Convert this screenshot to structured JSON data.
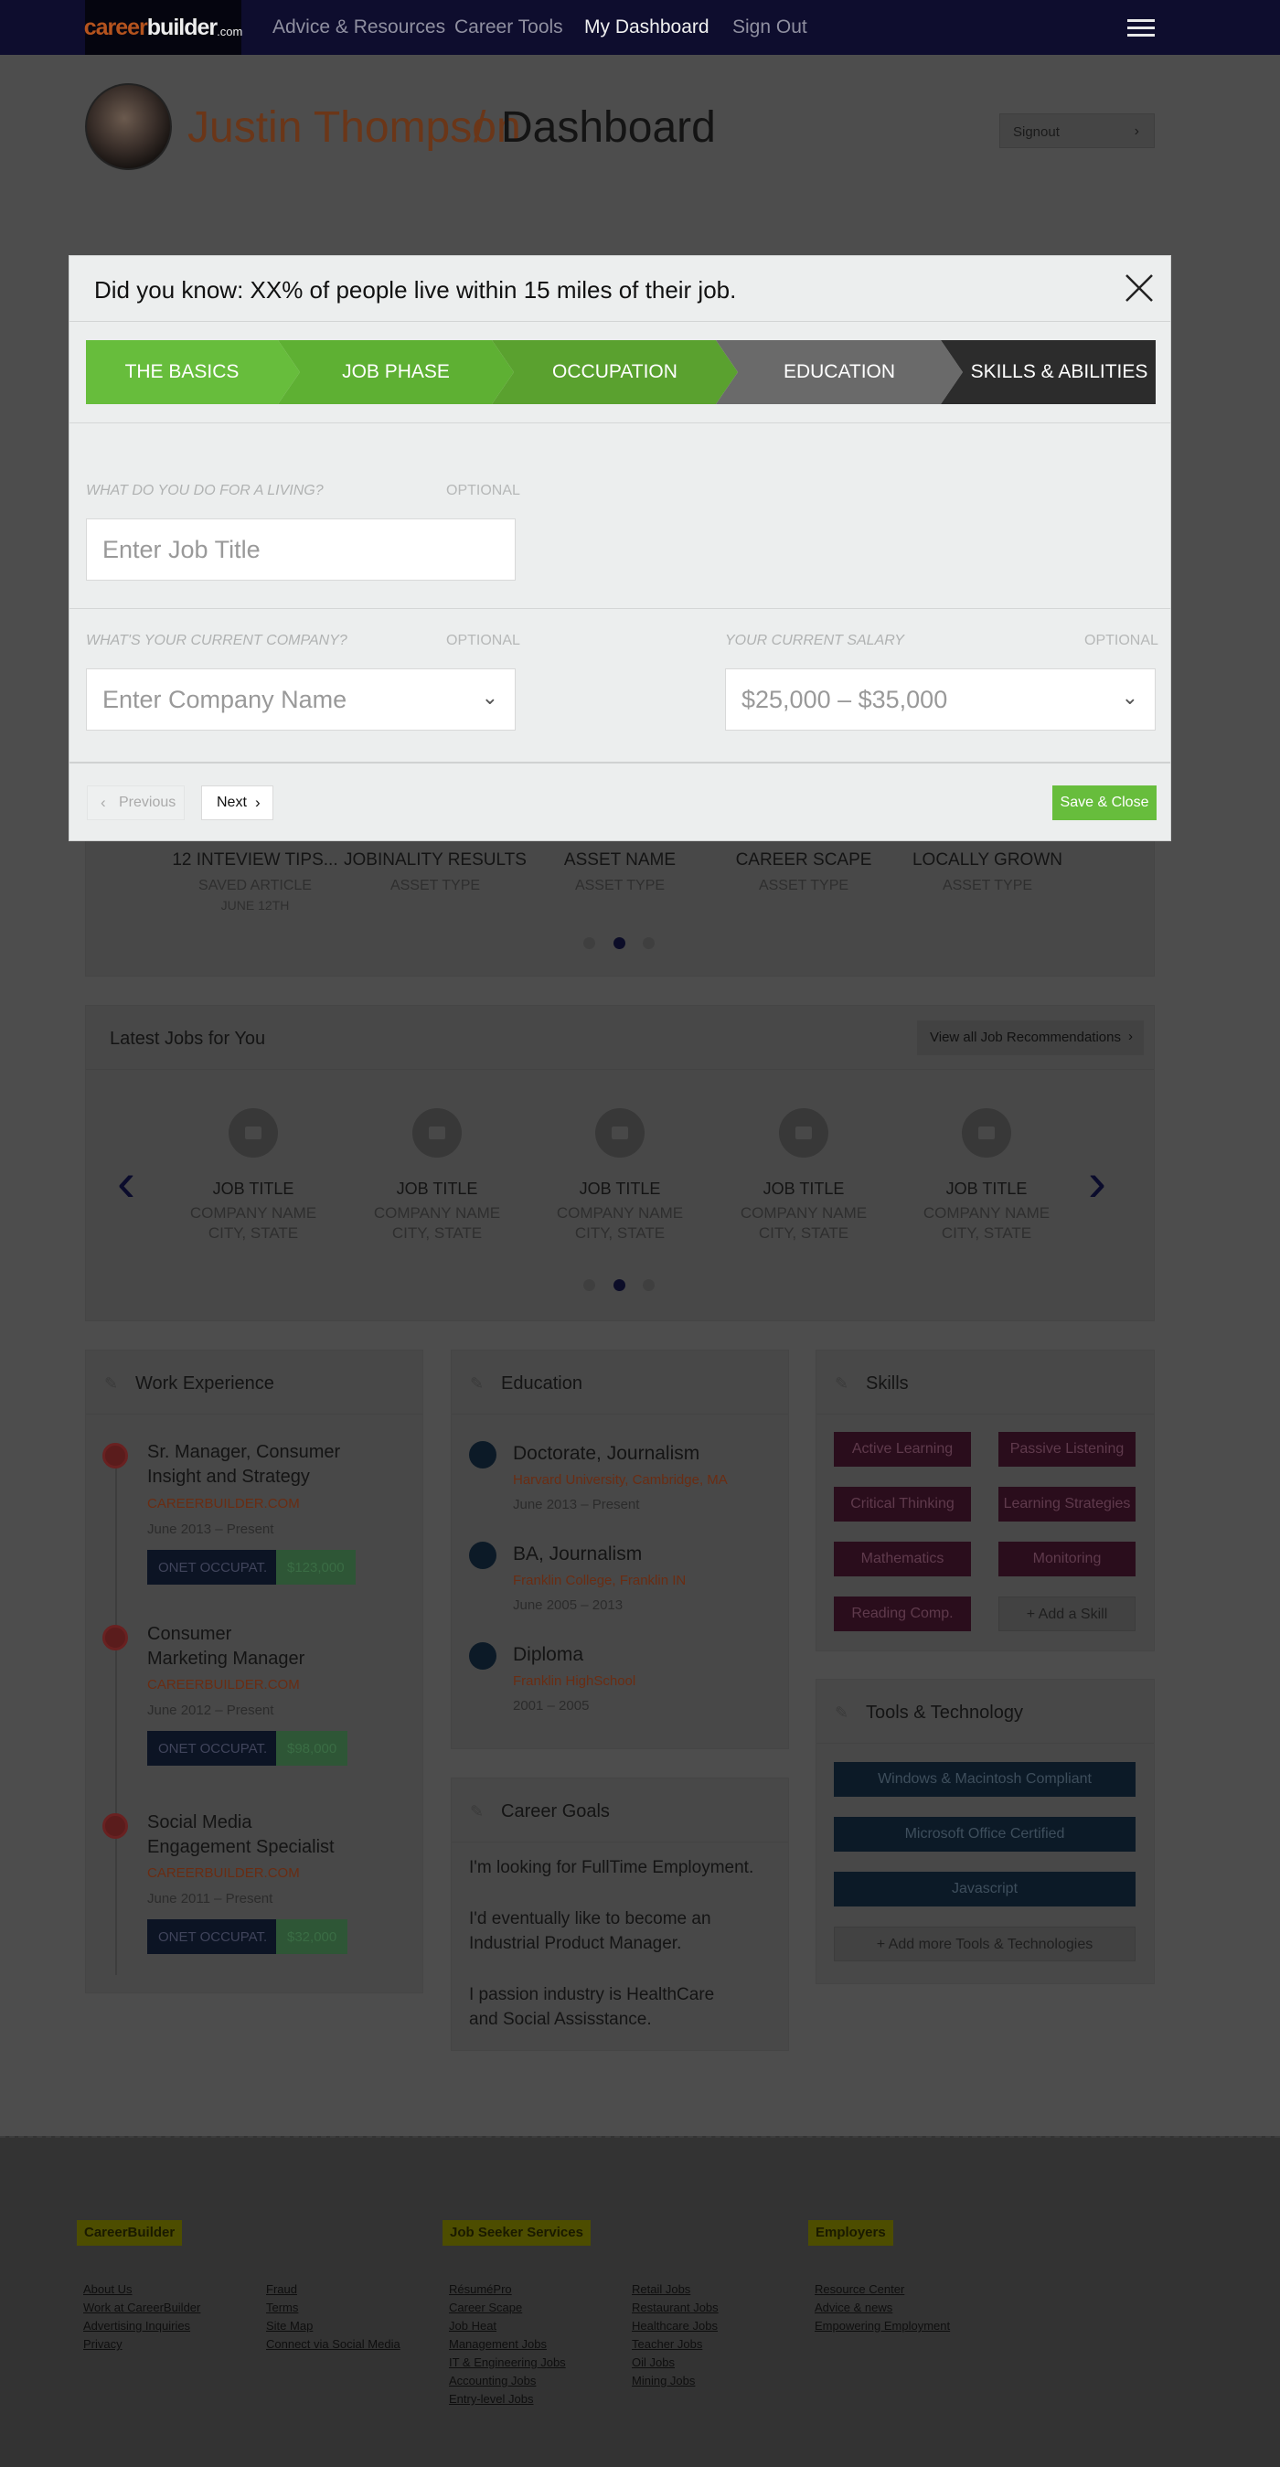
{
  "nav": {
    "logo_career": "career",
    "logo_builder": "builder",
    "logo_com": ".com",
    "links": [
      "Advice & Resources",
      "Career Tools",
      "My Dashboard",
      "Sign Out"
    ]
  },
  "header": {
    "name": "Justin Thompson",
    "slash": "/",
    "page": "Dashboard",
    "signout": "Signout"
  },
  "modal": {
    "title": "Did you know: XX% of people live within 15 miles of their job.",
    "steps": [
      "THE BASICS",
      "JOB PHASE",
      "OCCUPATION",
      "EDUCATION",
      "SKILLS & ABILITIES"
    ],
    "job_label": "WHAT DO YOU DO FOR A LIVING?",
    "optional": "OPTIONAL",
    "job_placeholder": "Enter Job Title",
    "company_label": "WHAT'S YOUR CURRENT COMPANY?",
    "company_placeholder": "Enter Company Name",
    "salary_label": "YOUR CURRENT SALARY",
    "salary_value": "$25,000 – $35,000",
    "prev": "Previous",
    "next": "Next",
    "save": "Save & Close"
  },
  "assets": [
    {
      "title": "12 INTEVIEW TIPS...",
      "type": "SAVED ARTICLE",
      "date": "JUNE 12TH"
    },
    {
      "title": "JOBINALITY RESULTS",
      "type": "ASSET TYPE",
      "date": ""
    },
    {
      "title": "ASSET NAME",
      "type": "ASSET TYPE",
      "date": ""
    },
    {
      "title": "CAREER SCAPE",
      "type": "ASSET TYPE",
      "date": ""
    },
    {
      "title": "LOCALLY GROWN",
      "type": "ASSET TYPE",
      "date": ""
    }
  ],
  "jobs": {
    "title": "Latest Jobs for You",
    "view_all": "View all Job Recommendations",
    "cards": [
      {
        "title": "JOB TITLE",
        "company": "COMPANY NAME",
        "location": "CITY, STATE"
      },
      {
        "title": "JOB TITLE",
        "company": "COMPANY NAME",
        "location": "CITY, STATE"
      },
      {
        "title": "JOB TITLE",
        "company": "COMPANY NAME",
        "location": "CITY, STATE"
      },
      {
        "title": "JOB TITLE",
        "company": "COMPANY NAME",
        "location": "CITY, STATE"
      },
      {
        "title": "JOB TITLE",
        "company": "COMPANY NAME",
        "location": "CITY, STATE"
      }
    ]
  },
  "work": {
    "title": "Work Experience",
    "items": [
      {
        "title1": "Sr. Manager, Consumer",
        "title2": "Insight and Strategy",
        "org": "CAREERBUILDER.COM",
        "dates": "June 2013 – Present",
        "tag": "ONET OCCUPAT.",
        "salary": "$123,000"
      },
      {
        "title1": "Consumer",
        "title2": "Marketing Manager",
        "org": "CAREERBUILDER.COM",
        "dates": "June 2012 – Present",
        "tag": "ONET OCCUPAT.",
        "salary": "$98,000"
      },
      {
        "title1": "Social Media",
        "title2": "Engagement Specialist",
        "org": "CAREERBUILDER.COM",
        "dates": "June 2011 – Present",
        "tag": "ONET OCCUPAT.",
        "salary": "$32,000"
      }
    ]
  },
  "education": {
    "title": "Education",
    "items": [
      {
        "degree": "Doctorate, Journalism",
        "school": "Harvard University, Cambridge, MA",
        "dates": "June 2013 – Present"
      },
      {
        "degree": "BA, Journalism",
        "school": "Franklin College, Franklin IN",
        "dates": "June 2005 – 2013"
      },
      {
        "degree": "Diploma",
        "school": "Franklin HighSchool",
        "dates": "2001 – 2005"
      }
    ]
  },
  "goals": {
    "title": "Career Goals",
    "g1": "I'm looking for FullTime Employment.",
    "g2a": "I'd eventually like to become an",
    "g2b": "Industrial Product Manager.",
    "g3a": "I passion industry is HealthCare",
    "g3b": "and Social Assisstance."
  },
  "skills": {
    "title": "Skills",
    "items": [
      "Active Learning",
      "Passive Listening",
      "Critical Thinking",
      "Learning Strategies",
      "Mathematics",
      "Monitoring",
      "Reading Comp."
    ],
    "add": "+ Add a Skill"
  },
  "tools": {
    "title": "Tools & Technology",
    "items": [
      "Windows & Macintosh Compliant",
      "Microsoft Office Certified",
      "Javascript"
    ],
    "add": "+ Add more Tools & Technologies"
  },
  "footer": {
    "col1_title": "CareerBuilder",
    "col1a": [
      "About Us",
      "Work at CareerBuilder",
      "Advertising Inquiries",
      "Privacy"
    ],
    "col1b": [
      "Fraud",
      "Terms",
      "Site Map",
      "Connect via Social Media"
    ],
    "col2_title": "Job Seeker Services",
    "col2a": [
      "RésuméPro",
      "Career Scape",
      "Job Heat",
      "Management Jobs",
      "IT & Engineering Jobs",
      "Accounting Jobs",
      "Entry-level Jobs"
    ],
    "col2b": [
      "Retail Jobs",
      "Restaurant Jobs",
      "Healthcare Jobs",
      "Teacher Jobs",
      "Oil Jobs",
      "Mining Jobs"
    ],
    "col3_title": "Employers",
    "col3a": [
      "Resource Center",
      "Advice & news",
      "Empowering Employment"
    ]
  },
  "colors": {
    "step_done": "#67bd3c",
    "step_current": "#5aa12f",
    "step_next": "#6a6a6a",
    "step_last": "#2c2c2c",
    "save_green": "#67bd3c"
  }
}
